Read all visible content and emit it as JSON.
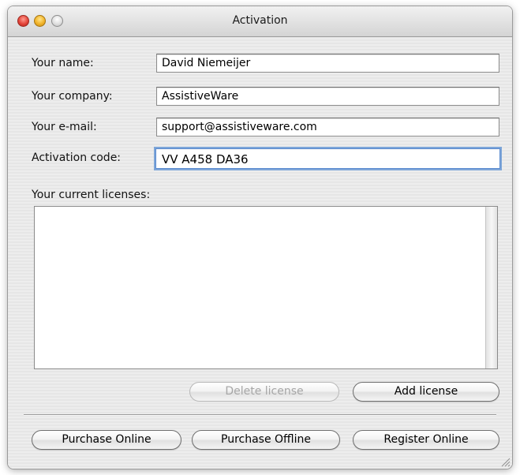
{
  "window": {
    "title": "Activation"
  },
  "form": {
    "name": {
      "label": "Your name:",
      "value": "David Niemeijer"
    },
    "company": {
      "label": "Your company:",
      "value": "AssistiveWare"
    },
    "email": {
      "label": "Your e-mail:",
      "value": "support@assistiveware.com"
    },
    "activation_code": {
      "label": "Activation code:",
      "value": "VV A458 DA36"
    }
  },
  "licenses": {
    "label": "Your current licenses:",
    "items": []
  },
  "buttons": {
    "delete_license": "Delete license",
    "add_license": "Add license",
    "purchase_online": "Purchase Online",
    "purchase_offline": "Purchase Offline",
    "register_online": "Register Online"
  },
  "colors": {
    "close": "#e3453a",
    "minimize": "#f1b32a",
    "focus_ring": "#7ea6d8"
  }
}
